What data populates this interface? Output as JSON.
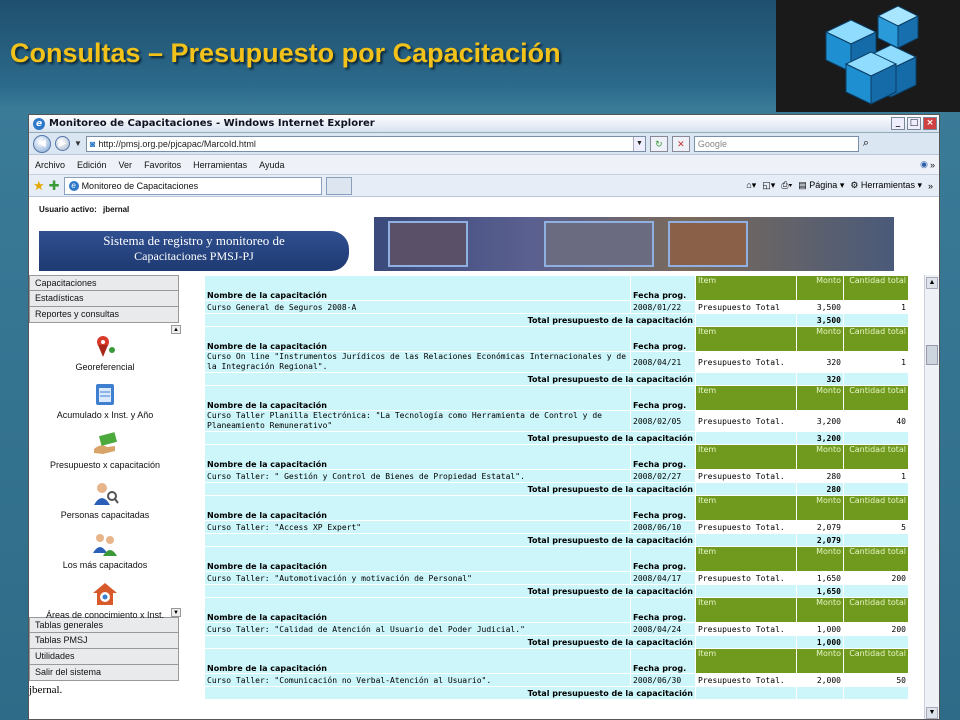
{
  "slide": {
    "title": "Consultas – Presupuesto por Capacitación"
  },
  "browser": {
    "window_title": "Monitoreo de Capacitaciones - Windows Internet Explorer",
    "url": "http://pmsj.org.pe/pjcapac/MarcoId.html",
    "search_placeholder": "Google",
    "menu": [
      "Archivo",
      "Edición",
      "Ver",
      "Favoritos",
      "Herramientas",
      "Ayuda"
    ],
    "tab_title": "Monitoreo de Capacitaciones",
    "tools": {
      "page": "Página",
      "tools": "Herramientas"
    }
  },
  "page": {
    "user_label": "Usuario activo:",
    "user_name": "jbernal",
    "banner_line1": "Sistema de registro y monitoreo de",
    "banner_line2": "Capacitaciones PMSJ-PJ",
    "footer_user": "jbernal."
  },
  "sidebar": {
    "top_menu": [
      "Capacitaciones",
      "Estadísticas",
      "Reportes y consultas"
    ],
    "links": [
      {
        "label": "Georeferencial",
        "icon": "map-pin-icon"
      },
      {
        "label": "Acumulado x  Inst. y Año",
        "icon": "calendar-icon"
      },
      {
        "label": "Presupuesto x capacitación",
        "icon": "money-hand-icon"
      },
      {
        "label": "Personas capacitadas",
        "icon": "person-search-icon"
      },
      {
        "label": "Los más capacitados",
        "icon": "users-icon"
      },
      {
        "label": "Áreas de conocimiento x Inst.",
        "icon": "knowledge-icon"
      }
    ],
    "bottom_menu": [
      "Tablas generales",
      "Tablas PMSJ",
      "Utilidades",
      "Salir del sistema"
    ]
  },
  "table": {
    "headers": {
      "name": "Nombre de la capacitación",
      "date": "Fecha prog.",
      "item": "Item",
      "amount": "Monto",
      "qty": "Cantidad total",
      "total_label": "Total presupuesto de la capacitación"
    },
    "groups": [
      {
        "name": "Curso General de Seguros 2008-A",
        "date": "2008/01/22",
        "item": "Presupuesto Total",
        "amount": "3,500",
        "qty": "1",
        "total": "3,500"
      },
      {
        "name": "Curso On line \"Instrumentos Jurídicos de las Relaciones Económicas Internacionales y de la Integración Regional\".",
        "date": "2008/04/21",
        "item": "Presupuesto Total.",
        "amount": "320",
        "qty": "1",
        "total": "320"
      },
      {
        "name": "Curso Taller Planilla Electrónica: \"La Tecnología como Herramienta de Control y de Planeamiento Remunerativo\"",
        "date": "2008/02/05",
        "item": "Presupuesto Total.",
        "amount": "3,200",
        "qty": "40",
        "total": "3,200"
      },
      {
        "name": "Curso Taller: \" Gestión y Control de Bienes de Propiedad Estatal\".",
        "date": "2008/02/27",
        "item": "Presupuesto Total.",
        "amount": "280",
        "qty": "1",
        "total": "280"
      },
      {
        "name": "Curso Taller: \"Access XP Expert\"",
        "date": "2008/06/10",
        "item": "Presupuesto Total.",
        "amount": "2,079",
        "qty": "5",
        "total": "2,079"
      },
      {
        "name": "Curso Taller: \"Automotivación y motivación de Personal\"",
        "date": "2008/04/17",
        "item": "Presupuesto Total.",
        "amount": "1,650",
        "qty": "200",
        "total": "1,650"
      },
      {
        "name": "Curso Taller: \"Calidad de Atención al Usuario del Poder Judicial.\"",
        "date": "2008/04/24",
        "item": "Presupuesto Total.",
        "amount": "1,000",
        "qty": "200",
        "total": "1,000"
      },
      {
        "name": "Curso Taller: \"Comunicación no Verbal-Atención al Usuario\".",
        "date": "2008/06/30",
        "item": "Presupuesto Total.",
        "amount": "2,000",
        "qty": "50",
        "total": ""
      }
    ]
  },
  "colors": {
    "title": "#f2c21a",
    "header_green": "#6f9a1d",
    "cell_cyan": "#ccf6fa"
  }
}
